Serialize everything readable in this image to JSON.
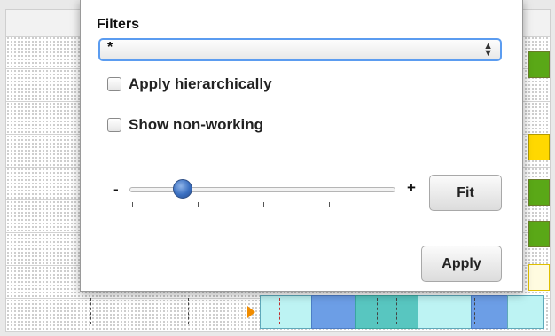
{
  "filters_panel": {
    "title": "Filters",
    "filter_select_value": "*",
    "apply_hierarchically_label": "Apply hierarchically",
    "apply_hierarchically_checked": false,
    "show_non_working_label": "Show non-working",
    "show_non_working_checked": false,
    "zoom_minus_label": "-",
    "zoom_plus_label": "+",
    "zoom_level": 0.2,
    "fit_button_label": "Fit",
    "apply_button_label": "Apply"
  },
  "colors": {
    "select_focus": "#5b9cf0",
    "slider_thumb": "#3a6fc1",
    "green_chip": "#5aa817",
    "yellow_chip": "#ffd800",
    "bar_light_cyan": "#bdf3f3",
    "bar_blue": "#6c9ee6",
    "bar_teal": "#58c6c0",
    "marker_orange": "#f08c00"
  }
}
